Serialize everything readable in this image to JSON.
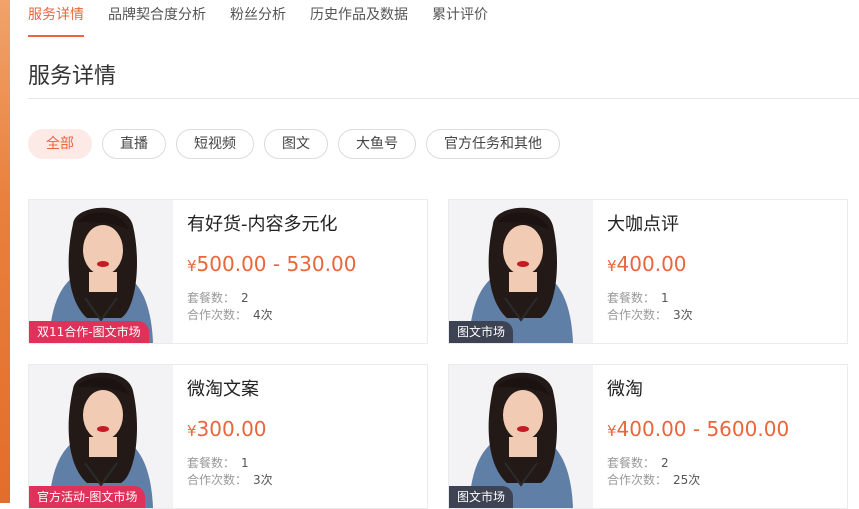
{
  "tabs": [
    {
      "label": "服务详情"
    },
    {
      "label": "品牌契合度分析"
    },
    {
      "label": "粉丝分析"
    },
    {
      "label": "历史作品及数据"
    },
    {
      "label": "累计评价"
    }
  ],
  "page_title": "服务详情",
  "filters": [
    {
      "label": "全部"
    },
    {
      "label": "直播"
    },
    {
      "label": "短视频"
    },
    {
      "label": "图文"
    },
    {
      "label": "大鱼号"
    },
    {
      "label": "官方任务和其他"
    }
  ],
  "labels": {
    "packages": "套餐数：",
    "collabs": "合作次数："
  },
  "currency": "¥",
  "cards": [
    {
      "name": "有好货-内容多元化",
      "price": "500.00 - 530.00",
      "packages": "2",
      "collabs": "4次",
      "tag": "双11合作-图文市场"
    },
    {
      "name": "大咖点评",
      "price": "400.00",
      "packages": "1",
      "collabs": "3次",
      "tag": "图文市场"
    },
    {
      "name": "微淘文案",
      "price": "300.00",
      "packages": "1",
      "collabs": "3次",
      "tag": "官方活动-图文市场"
    },
    {
      "name": "微淘",
      "price": "400.00 - 5600.00",
      "packages": "2",
      "collabs": "25次",
      "tag": "图文市场"
    }
  ],
  "colors": {
    "accent": "#e9663b",
    "tag_red": "#e0315a",
    "tag_dark": "#3d4352"
  }
}
